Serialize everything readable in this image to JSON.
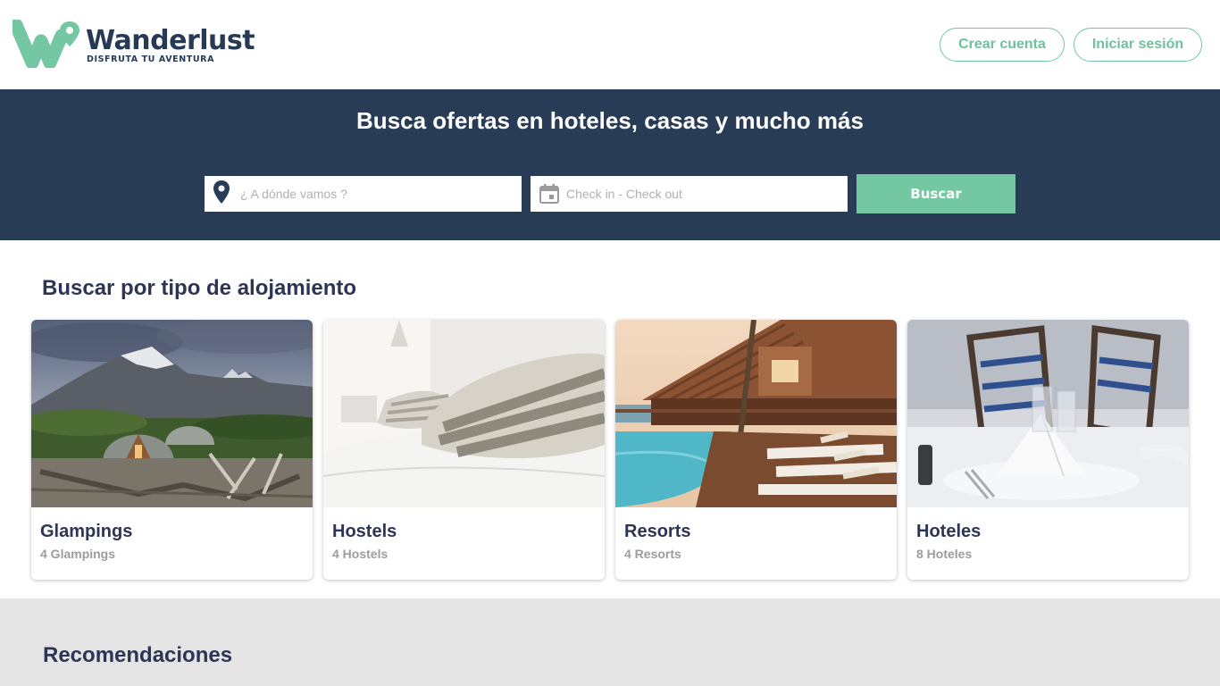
{
  "brand": {
    "name": "Wanderlust",
    "tagline": "DISFRUTA TU AVENTURA",
    "colors": {
      "primary_dark": "#283c56",
      "accent_green": "#74c7a3"
    }
  },
  "header": {
    "create_account_label": "Crear cuenta",
    "login_label": "Iniciar sesión"
  },
  "hero": {
    "title": "Busca ofertas en hoteles, casas y mucho más",
    "destination_placeholder": "¿ A dónde vamos ?",
    "destination_icon": "location-pin-icon",
    "dates_placeholder": "Check in - Check out",
    "dates_icon": "calendar-icon",
    "search_label": "Buscar"
  },
  "categories": {
    "title": "Buscar por tipo de alojamiento",
    "items": [
      {
        "title": "Glampings",
        "count": "4 Glampings"
      },
      {
        "title": "Hostels",
        "count": "4 Hostels"
      },
      {
        "title": "Resorts",
        "count": "4 Resorts"
      },
      {
        "title": "Hoteles",
        "count": "8 Hoteles"
      }
    ]
  },
  "recommendations": {
    "title": "Recomendaciones"
  }
}
